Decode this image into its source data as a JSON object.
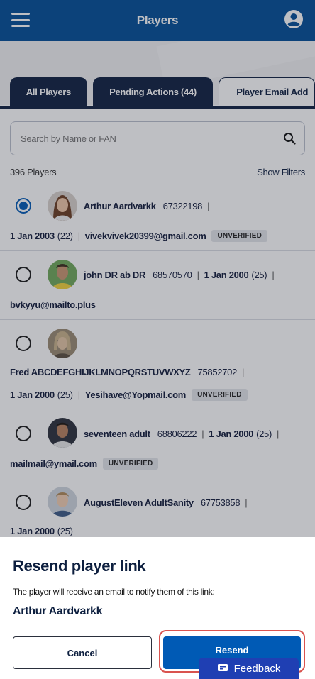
{
  "header": {
    "title": "Players"
  },
  "tabs": [
    {
      "label": "All Players",
      "active": true
    },
    {
      "label": "Pending Actions (44)",
      "active": false
    },
    {
      "label": "Player Email Add",
      "active": false
    }
  ],
  "search": {
    "placeholder": "Search by Name or FAN",
    "icon": "search-icon"
  },
  "count_label": "396 Players",
  "show_filters": "Show Filters",
  "players": [
    {
      "name": "Arthur Aardvarkk",
      "fan": "67322198",
      "dob": "1 Jan 2003",
      "age": "(22)",
      "email": "vivekvivek20399@gmail.com",
      "badge": "UNVERIFIED",
      "selected": true
    },
    {
      "name": "john DR ab DR",
      "fan": "68570570",
      "dob": "1 Jan 2000",
      "age": "(25)",
      "email": "bvkyyu@mailto.plus",
      "selected": false
    },
    {
      "name": "Fred ABCDEFGHIJKLMNOPQRSTUVWXYZ",
      "fan": "75852702",
      "dob": "1 Jan 2000",
      "age": "(25)",
      "email": "Yesihave@Yopmail.com",
      "badge": "UNVERIFIED",
      "selected": false
    },
    {
      "name": "seventeen adult",
      "fan": "68806222",
      "dob": "1 Jan 2000",
      "age": "(25)",
      "email": "mailmail@ymail.com",
      "badge": "UNVERIFIED",
      "selected": false
    },
    {
      "name": "AugustEleven AdultSanity",
      "fan": "67753858",
      "dob": "1 Jan 2000",
      "age": "(25)",
      "selected": false
    }
  ],
  "dialog": {
    "title": "Resend player link",
    "message": "The player will receive an email to notify them of this link:",
    "player_name": "Arthur Aardvarkk",
    "cancel_label": "Cancel",
    "resend_label": "Resend"
  },
  "feedback_label": "Feedback",
  "colors": {
    "header": "#004c97",
    "tab_dark": "#0d1f3f",
    "primary": "#005ab5",
    "highlight": "#d9534f",
    "feedback": "#1f3fb3"
  }
}
